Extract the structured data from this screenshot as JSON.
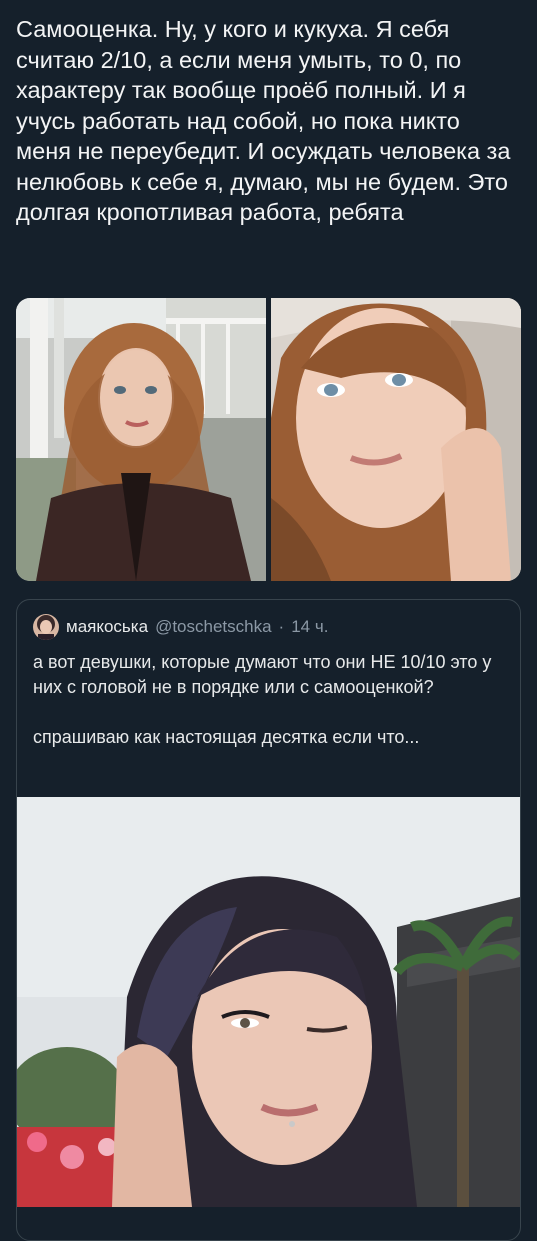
{
  "post": {
    "text": "Самооценка. Ну, у кого и кукуха. Я себя считаю 2/10, а если меня умыть, то 0, по характеру так вообще проёб полный. И я учусь работать над собой, но пока никто меня не переубедит. И осуждать человека за нелюбовь к себе я, думаю, мы не будем. Это долгая кропотливая работа, ребята"
  },
  "media": {
    "photo_left": "selfie-photo",
    "photo_right": "portrait-photo"
  },
  "quote": {
    "name": "маякоська",
    "handle": "@toschetschka",
    "separator": "·",
    "time": "14 ч.",
    "text": "а вот девушки, которые думают что они НЕ 10/10 это у них с головой не в порядке или с самооценкой?\n\nспрашиваю как настоящая десятка если что...",
    "photo": "winking-selfie-photo"
  },
  "colors": {
    "background": "#15202b",
    "text": "#e7e9ea",
    "secondary_text": "#8b98a5",
    "border": "#38444d"
  }
}
